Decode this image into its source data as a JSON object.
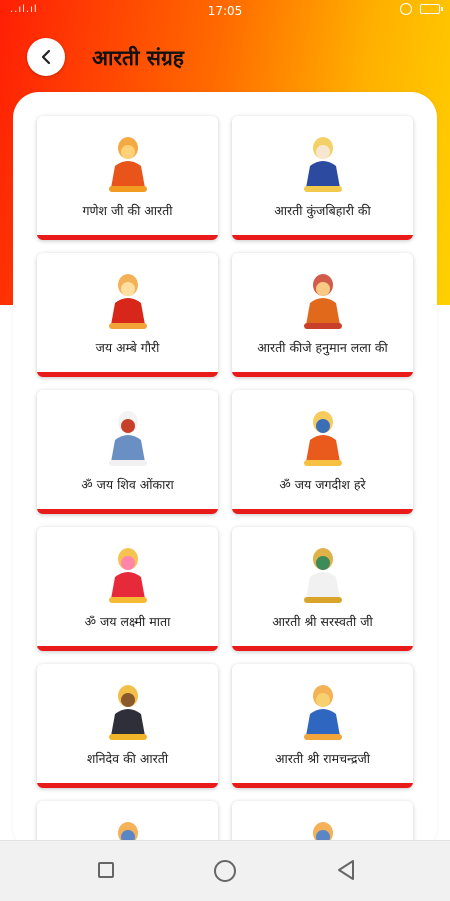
{
  "status_bar": {
    "signal": "..ıl.ıl",
    "time": "17:05",
    "icons": [
      "alarm-icon",
      "battery-icon"
    ]
  },
  "header": {
    "back_icon": "chevron-left",
    "title": "आरती संग्रह"
  },
  "colors": {
    "header_gradient": [
      "#ff1f05",
      "#ff6a00",
      "#ffb000",
      "#ffd100"
    ],
    "card_accent": "#e81a1a"
  },
  "cards": [
    {
      "label": "गणेश जी की आरती",
      "icon": "ganesh-image"
    },
    {
      "label": "आरती कुंजबिहारी की",
      "icon": "krishna-image"
    },
    {
      "label": "जय अम्बे गौरी",
      "icon": "durga-image"
    },
    {
      "label": "आरती कीजे हनुमान लला की",
      "icon": "hanuman-image"
    },
    {
      "label": "ॐ जय शिव ओंकारा",
      "icon": "shiva-image"
    },
    {
      "label": "ॐ जय जगदीश हरे",
      "icon": "vishnu-image"
    },
    {
      "label": "ॐ जय लक्ष्मी माता",
      "icon": "lakshmi-image"
    },
    {
      "label": "आरती श्री सरस्वती जी",
      "icon": "saraswati-image"
    },
    {
      "label": "शनिदेव की आरती",
      "icon": "shanidev-image"
    },
    {
      "label": "आरती श्री रामचन्द्रजी",
      "icon": "ram-image"
    },
    {
      "label": "",
      "icon": "deity-image"
    },
    {
      "label": "",
      "icon": "deity-image"
    }
  ],
  "nav": {
    "icons": [
      "recent-apps-icon",
      "home-icon",
      "back-triangle-icon"
    ]
  }
}
